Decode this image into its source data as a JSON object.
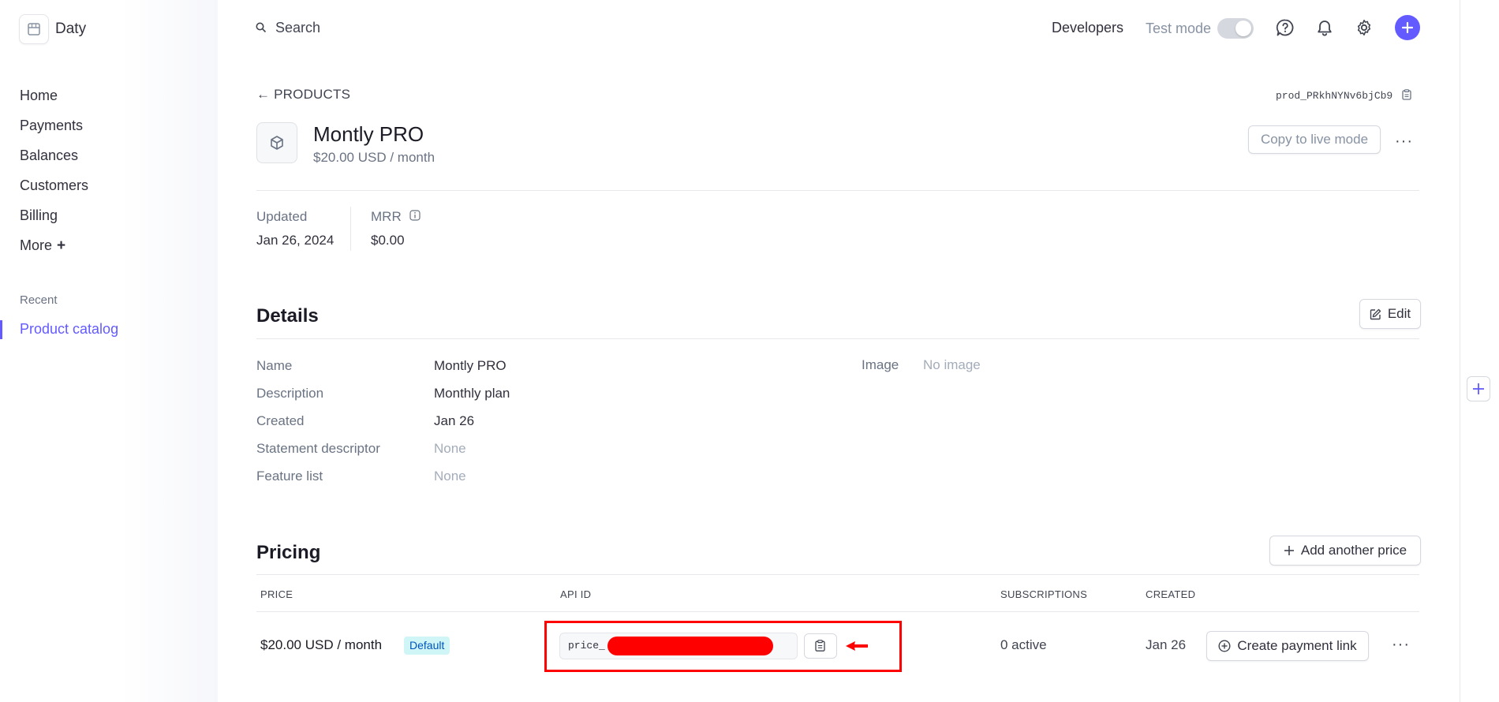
{
  "sidebar": {
    "account_name": "Daty",
    "nav": [
      {
        "label": "Home"
      },
      {
        "label": "Payments"
      },
      {
        "label": "Balances"
      },
      {
        "label": "Customers"
      },
      {
        "label": "Billing"
      },
      {
        "label": "More"
      }
    ],
    "recent_label": "Recent",
    "recent_items": [
      {
        "label": "Product catalog",
        "active": true
      }
    ]
  },
  "topbar": {
    "search_label": "Search",
    "developers_label": "Developers",
    "test_mode_label": "Test mode",
    "test_mode_on": false,
    "icons": [
      "help-icon",
      "bell-icon",
      "gear-icon",
      "plus-icon"
    ]
  },
  "header": {
    "back_label": "PRODUCTS",
    "product_id": "prod_PRkhNYNv6bjCb9",
    "title": "Montly PRO",
    "subtitle": "$20.00 USD / month",
    "copy_live_label": "Copy to live mode",
    "more_label": "···"
  },
  "meta": {
    "updated_label": "Updated",
    "updated_value": "Jan 26, 2024",
    "mrr_label": "MRR",
    "mrr_value": "$0.00"
  },
  "details": {
    "title": "Details",
    "edit_label": "Edit",
    "rows": [
      {
        "label": "Name",
        "value": "Montly PRO"
      },
      {
        "label": "Description",
        "value": "Monthly plan"
      },
      {
        "label": "Created",
        "value": "Jan 26"
      },
      {
        "label": "Statement descriptor",
        "value": "None"
      },
      {
        "label": "Feature list",
        "value": "None"
      }
    ],
    "image_label": "Image",
    "image_value": "No image"
  },
  "pricing": {
    "title": "Pricing",
    "add_price_label": "Add another price",
    "columns": [
      "PRICE",
      "API ID",
      "SUBSCRIPTIONS",
      "CREATED"
    ],
    "rows": [
      {
        "price": "$20.00 USD / month",
        "badge": "Default",
        "api_id_prefix": "price_",
        "subscriptions": "0 active",
        "created": "Jan 26",
        "action_label": "Create payment link",
        "more_label": "···"
      }
    ]
  },
  "colors": {
    "accent": "#635bff",
    "annotation": "#ff0000",
    "badge_bg": "#cff5f6",
    "badge_text": "#0055bc"
  }
}
